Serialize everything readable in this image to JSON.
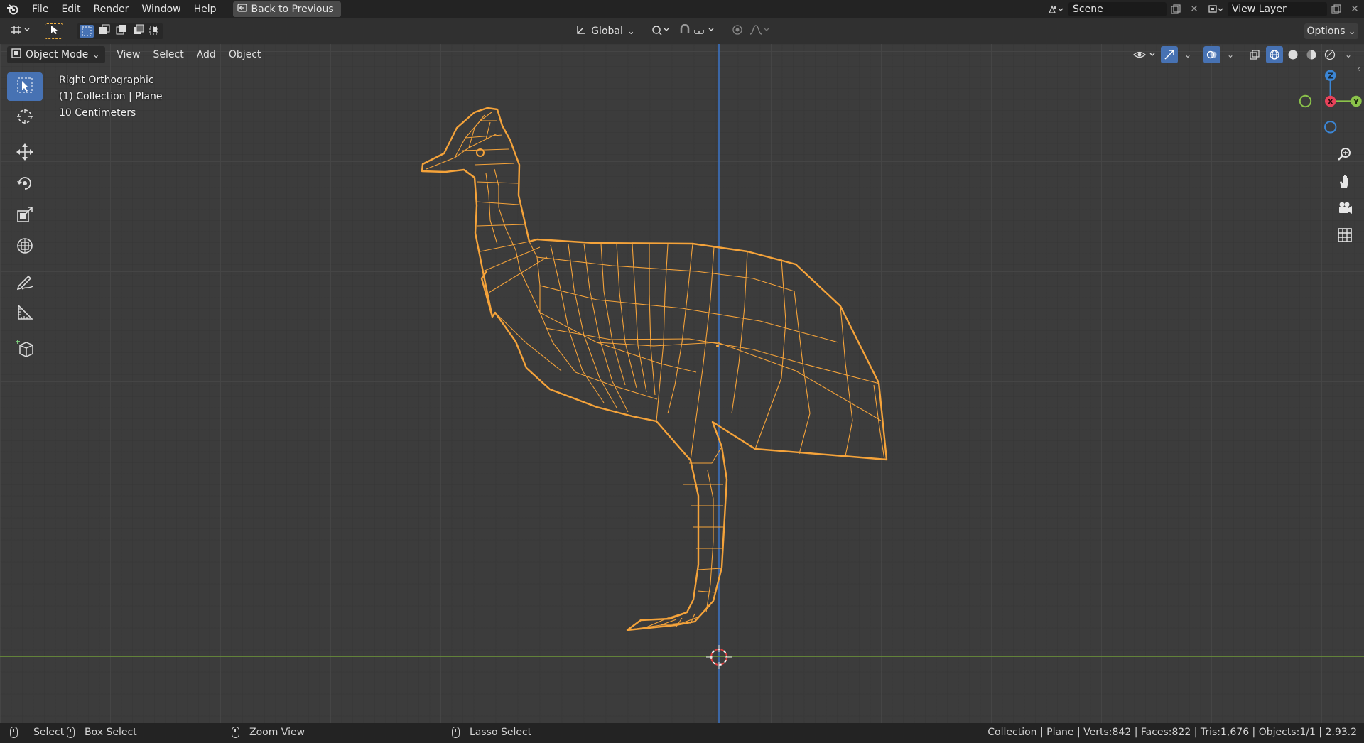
{
  "topbar": {
    "menus": [
      "File",
      "Edit",
      "Render",
      "Window",
      "Help"
    ],
    "back_button": "Back to Previous",
    "scene_label": "Scene",
    "view_layer_label": "View Layer"
  },
  "header": {
    "orientation": "Global",
    "options_label": "Options"
  },
  "viewport": {
    "mode": "Object Mode",
    "menus": [
      "View",
      "Select",
      "Add",
      "Object"
    ],
    "info": {
      "view_name": "Right Orthographic",
      "collection": "(1) Collection | Plane",
      "scale": "10 Centimeters"
    },
    "gizmo": {
      "z": "Z",
      "x": "X",
      "y": "Y"
    }
  },
  "statusbar": {
    "select": "Select",
    "box_select": "Box Select",
    "zoom_view": "Zoom View",
    "lasso_select": "Lasso Select",
    "stats": "Collection | Plane | Verts:842 | Faces:822 | Tris:1,676 | Objects:1/1 | 2.93.2"
  },
  "colors": {
    "wire": "#f5a33a",
    "active_tool": "#4772b3",
    "axis_x": "#e8425a",
    "axis_y": "#8bc34a",
    "axis_z": "#3b86d6"
  }
}
